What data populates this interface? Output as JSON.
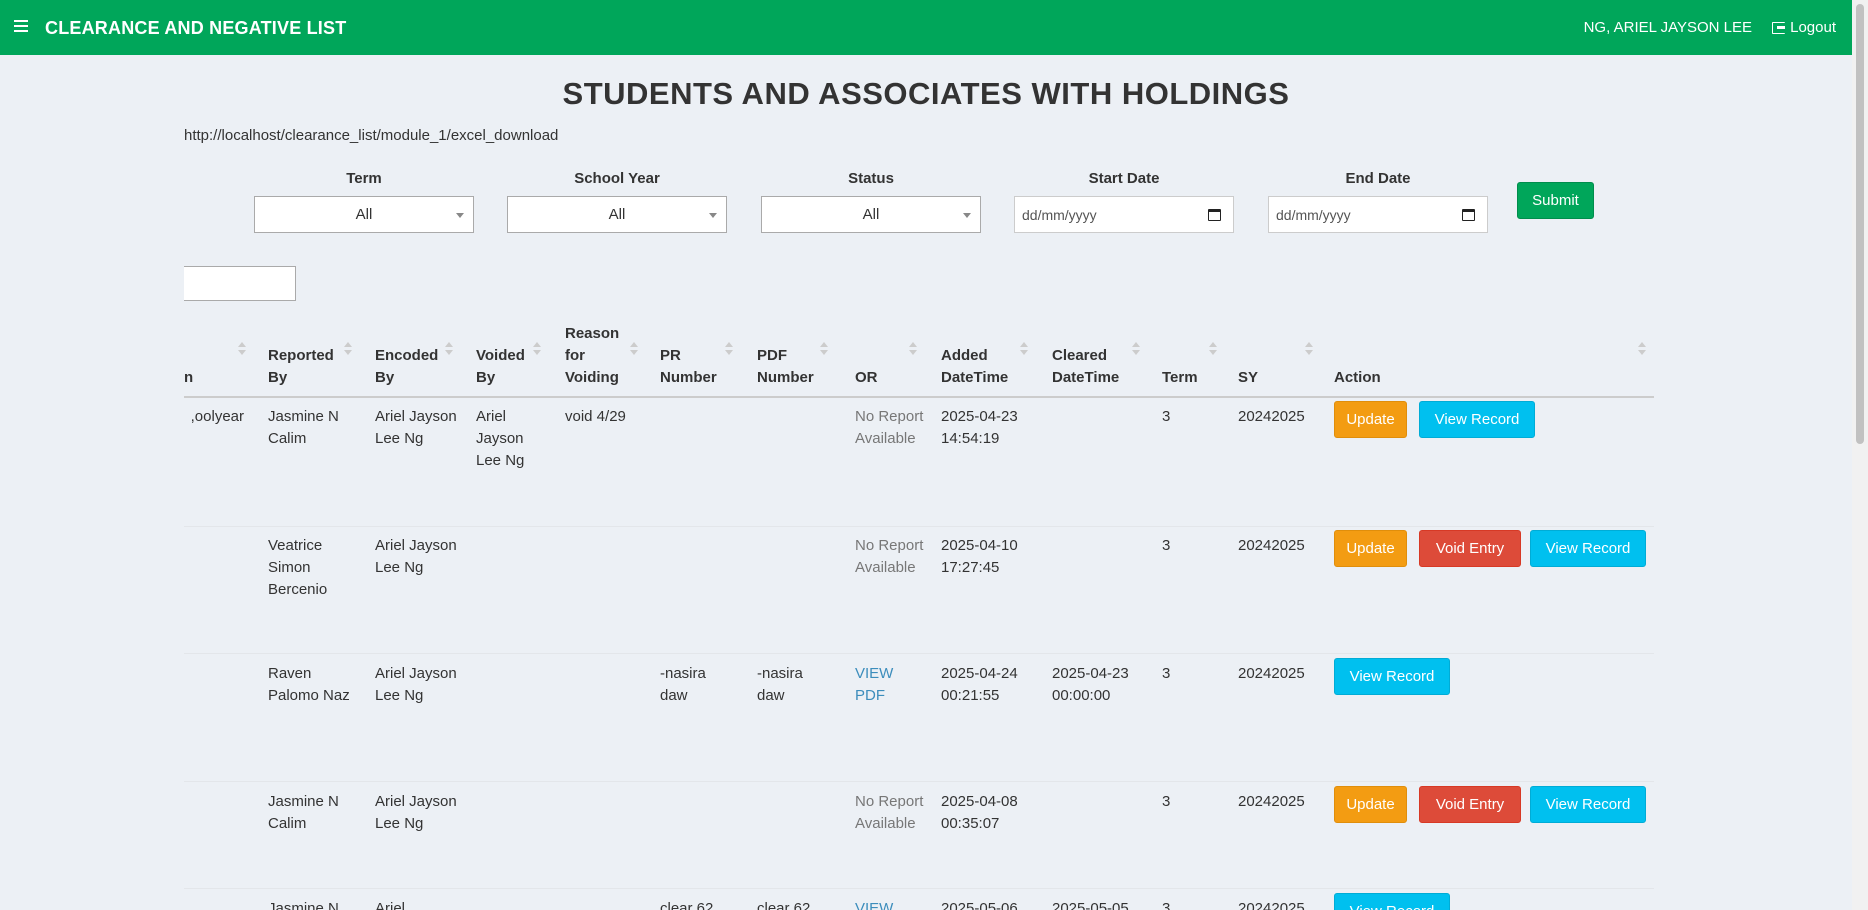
{
  "header": {
    "title": "CLEARANCE AND NEGATIVE LIST",
    "user": "NG, ARIEL JAYSON LEE",
    "logout": "Logout",
    "brand_color": "#00a65a"
  },
  "page": {
    "title": "STUDENTS AND ASSOCIATES WITH HOLDINGS",
    "url": "http://localhost/clearance_list/module_1/excel_download"
  },
  "filters": {
    "term_label": "Term",
    "term_value": "All",
    "school_year_label": "School Year",
    "school_year_value": "All",
    "status_label": "Status",
    "status_value": "All",
    "start_date_label": "Start Date",
    "start_date_placeholder": "dd/mm/yyyy",
    "end_date_label": "End Date",
    "end_date_placeholder": "dd/mm/yyyy",
    "submit": "Submit"
  },
  "table": {
    "columns": {
      "cut": "n",
      "reported_by": "Reported By",
      "encoded_by": "Encoded By",
      "voided_by": "Voided By",
      "reason": "Reason for Voiding",
      "pr_number": "PR Number",
      "pdf_number": "PDF Number",
      "or": "OR",
      "added": "Added DateTime",
      "cleared": "Cleared DateTime",
      "term": "Term",
      "sy": "SY",
      "action": "Action"
    },
    "buttons": {
      "update": "Update",
      "void": "Void Entry",
      "view": "View Record"
    },
    "rows": [
      {
        "cut": "oolyear,",
        "reported_by": "Jasmine N Calim",
        "encoded_by": "Ariel Jayson Lee Ng",
        "voided_by": "Ariel Jayson Lee Ng",
        "reason": "void 4/29",
        "pr_number": "",
        "pdf_number": "",
        "or": "No Report Available",
        "added": "2025-04-23 14:54:19",
        "cleared": "",
        "term": "3",
        "sy": "20242025"
      },
      {
        "cut": "",
        "reported_by": "Veatrice Simon Bercenio",
        "encoded_by": "Ariel Jayson Lee Ng",
        "voided_by": "",
        "reason": "",
        "pr_number": "",
        "pdf_number": "",
        "or": "No Report Available",
        "added": "2025-04-10 17:27:45",
        "cleared": "",
        "term": "3",
        "sy": "20242025"
      },
      {
        "cut": "",
        "reported_by": "Raven Palomo Naz",
        "encoded_by": "Ariel Jayson Lee Ng",
        "voided_by": "",
        "reason": "",
        "pr_number": "-nasira daw",
        "pdf_number": "-nasira daw",
        "or": "VIEW PDF",
        "added": "2025-04-24 00:21:55",
        "cleared": "2025-04-23 00:00:00",
        "term": "3",
        "sy": "20242025"
      },
      {
        "cut": "",
        "reported_by": "Jasmine N Calim",
        "encoded_by": "Ariel Jayson Lee Ng",
        "voided_by": "",
        "reason": "",
        "pr_number": "",
        "pdf_number": "",
        "or": "No Report Available",
        "added": "2025-04-08 00:35:07",
        "cleared": "",
        "term": "3",
        "sy": "20242025"
      },
      {
        "cut": "",
        "reported_by": "Jasmine N",
        "encoded_by": "Ariel",
        "voided_by": "",
        "reason": "",
        "pr_number": "clear 62",
        "pdf_number": "clear 62",
        "or": "VIEW",
        "added": "2025-05-06",
        "cleared": "2025-05-05",
        "term": "3",
        "sy": "20242025"
      }
    ]
  }
}
